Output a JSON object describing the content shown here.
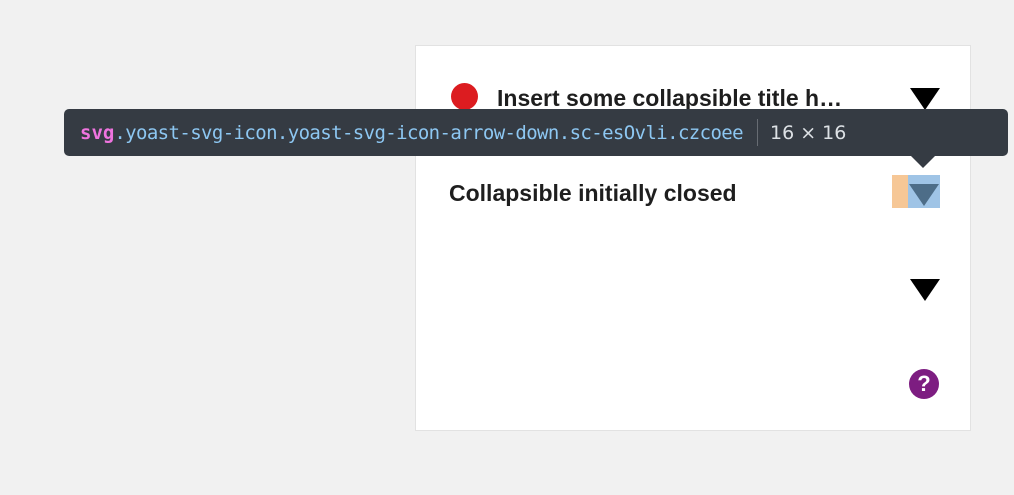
{
  "collapsibles": [
    {
      "title": "Insert some collapsible title h…",
      "has_bullet": true,
      "icon": "arrow-down-icon"
    },
    {
      "title": "Collapsible initially closed",
      "has_bullet": false,
      "icon": "arrow-down-icon"
    },
    {
      "title": "",
      "has_bullet": false,
      "icon": "arrow-down-icon"
    }
  ],
  "help": {
    "icon": "question-mark-icon",
    "glyph": "?"
  },
  "inspector_tooltip": {
    "tag": "svg",
    "classes": ".yoast-svg-icon.yoast-svg-icon-arrow-down.sc-esOvli.czcoee",
    "dimensions": "16 × 16"
  },
  "colors": {
    "bullet": "#dc1c20",
    "help": "#7d1d81",
    "tooltip_bg": "#353b43",
    "tooltip_tag": "#ef74df",
    "tooltip_classes": "#8dc7f2",
    "inspect_padding": "#f6c796",
    "inspect_content": "#9fc4e6"
  }
}
